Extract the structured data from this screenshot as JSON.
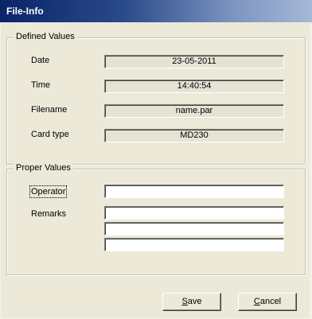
{
  "window": {
    "title": "File-Info"
  },
  "defined_values": {
    "title": "Defined Values",
    "rows": [
      {
        "label": "Date",
        "value": "23-05-2011"
      },
      {
        "label": "Time",
        "value": "14:40:54"
      },
      {
        "label": "Filename",
        "value": "name.par"
      },
      {
        "label": "Card type",
        "value": "MD230"
      }
    ]
  },
  "proper_values": {
    "title": "Proper Values",
    "operator": {
      "label": "Operator",
      "value": ""
    },
    "remarks": {
      "label": "Remarks",
      "lines": [
        "",
        "",
        ""
      ]
    }
  },
  "buttons": {
    "save": {
      "mnemonic": "S",
      "rest": "ave"
    },
    "cancel": {
      "mnemonic": "C",
      "rest": "ancel"
    }
  },
  "colors": {
    "titlebar_start": "#0a246a",
    "titlebar_end": "#a6b8d8",
    "dialog_background": "#ece9d8",
    "readonly_field": "#e6e3d4"
  }
}
